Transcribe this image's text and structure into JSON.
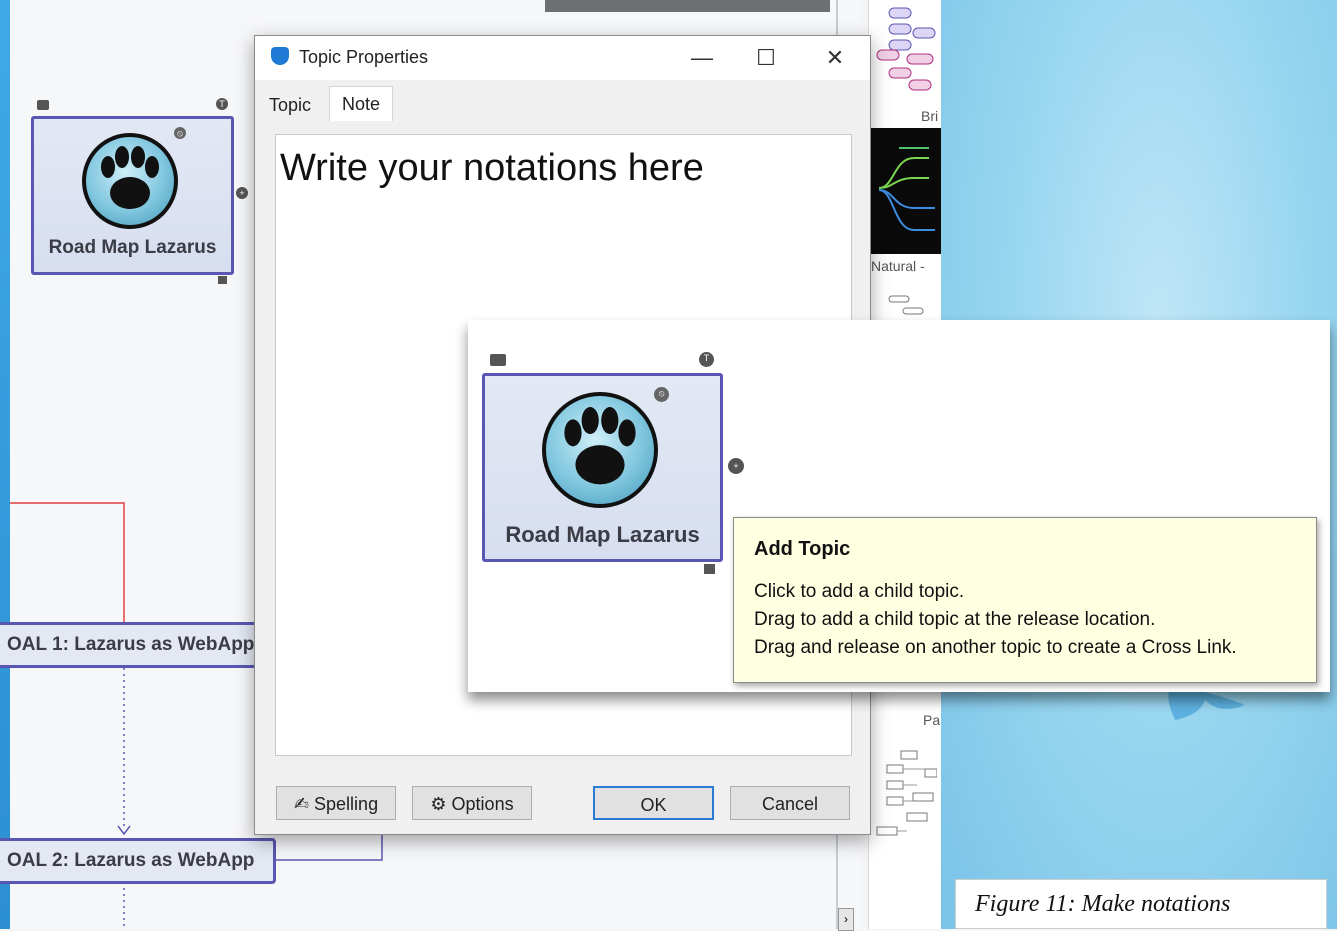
{
  "dialog": {
    "title": "Topic Properties",
    "tabs": [
      {
        "label": "Topic"
      },
      {
        "label": "Note"
      }
    ],
    "active_tab": "Note",
    "note_text": "Write your notations here",
    "buttons": {
      "spelling": "Spelling",
      "options": "Options",
      "ok": "OK",
      "cancel": "Cancel"
    },
    "window_controls": {
      "minimize": "—",
      "maximize": "☐",
      "close": "✕"
    }
  },
  "map": {
    "main_topic": "Road Map Lazarus",
    "goal1": "OAL 1: Lazarus as WebApp",
    "goal2": "OAL 2: Lazarus as WebApp"
  },
  "templates": {
    "labels": [
      "Bri",
      "Natural -",
      "Pa"
    ]
  },
  "inset": {
    "topic_label": "Road Map Lazarus",
    "tooltip": {
      "title": "Add Topic",
      "lines": [
        "Click to add a child topic.",
        "Drag to add a child topic at the release location.",
        "Drag and release on another topic to create a Cross Link."
      ]
    }
  },
  "caption": "Figure 11: Make notations",
  "colors": {
    "node_border": "#5a57b4",
    "tooltip_bg": "#ffffe1",
    "accent_blue": "#1f7ad6",
    "sky": "#9ad7f0",
    "connector_red": "#e04040"
  }
}
